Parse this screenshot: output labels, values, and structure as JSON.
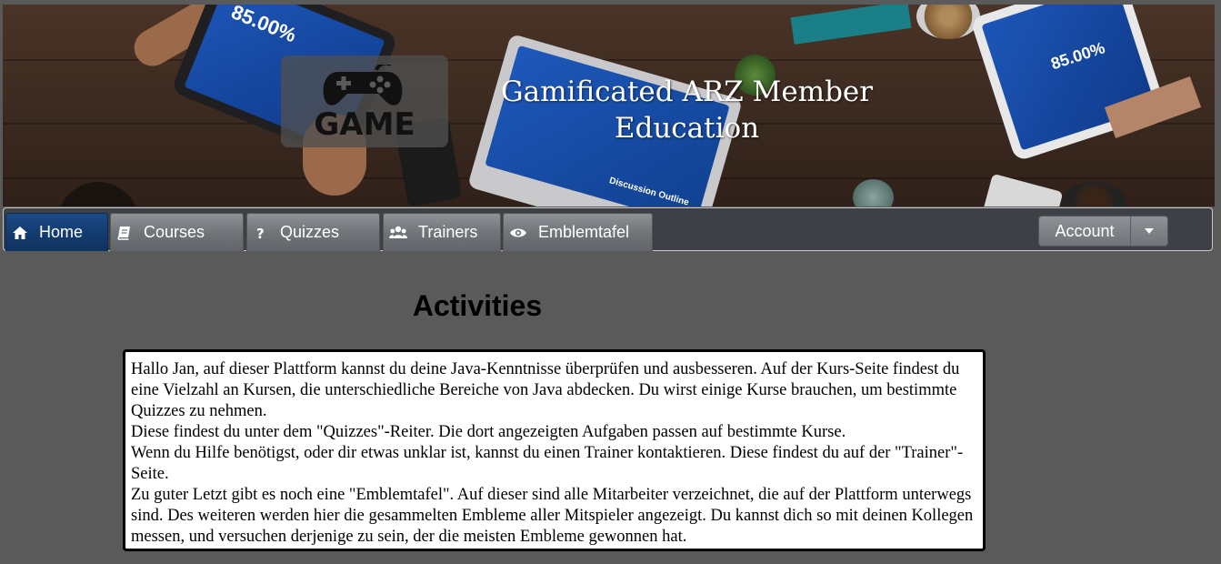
{
  "banner": {
    "title_line1": "Gamificated ARZ Member",
    "title_line2": "Education",
    "logo_text": "GAME",
    "logo_icon": "gamepad-icon",
    "tablet_left_text": "85.00%",
    "tablet_right_text": "85.00%",
    "laptop_text": "Discussion Outline"
  },
  "nav": {
    "tabs": [
      {
        "label": "Home",
        "icon": "home-icon",
        "active": true
      },
      {
        "label": "Courses",
        "icon": "book-icon",
        "active": false
      },
      {
        "label": "Quizzes",
        "icon": "question-icon",
        "active": false
      },
      {
        "label": "Trainers",
        "icon": "users-icon",
        "active": false
      },
      {
        "label": "Emblemtafel",
        "icon": "eye-icon",
        "active": false
      }
    ],
    "account": {
      "label": "Account",
      "icon": "caret-down-icon"
    }
  },
  "main": {
    "heading": "Activities",
    "paragraphs": [
      "Hallo Jan, auf dieser Plattform kannst du deine Java-Kenntnisse überprüfen und ausbesseren. Auf der Kurs-Seite findest du eine Vielzahl an Kursen, die unterschiedliche Bereiche von Java abdecken. Du wirst einige Kurse brauchen, um bestimmte Quizzes zu nehmen.",
      "Diese findest du unter dem \"Quizzes\"-Reiter. Die dort angezeigten Aufgaben passen auf bestimmte Kurse.",
      "Wenn du Hilfe benötigst, oder dir etwas unklar ist, kannst du einen Trainer kontaktieren. Diese findest du auf der \"Trainer\"-Seite.",
      "Zu guter Letzt gibt es noch eine \"Emblemtafel\". Auf dieser sind alle Mitarbeiter verzeichnet, die auf der Plattform unterwegs sind. Des weiteren werden hier die gesammelten Embleme aller Mitspieler angezeigt. Du kannst dich so mit deinen Kollegen messen, und versuchen derjenige zu sein, der die meisten Embleme gewonnen hat."
    ]
  },
  "colors": {
    "page_bg": "#5a5a5a",
    "nav_bg": "#3d4145",
    "active_tab": "#123a6d",
    "inactive_tab": "#6e7377"
  }
}
